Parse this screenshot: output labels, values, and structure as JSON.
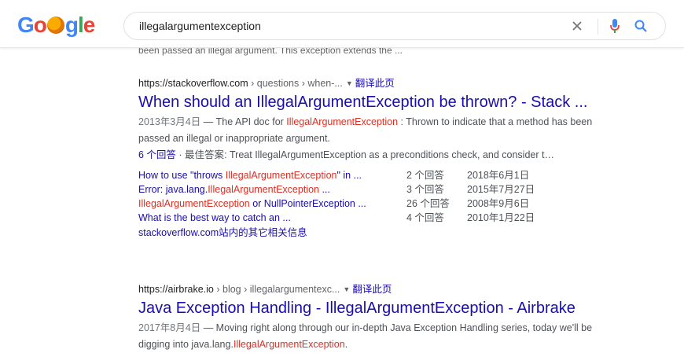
{
  "logo": {
    "text": "Google"
  },
  "search": {
    "query": "illegalargumentexception"
  },
  "cut_snippet": "been passed an illegal argument. This exception extends the ...",
  "results": [
    {
      "url": "https://stackoverflow.com",
      "crumbs": " › questions › when-...",
      "translate": "翻译此页",
      "title": "When should an IllegalArgumentException be thrown? - Stack ...",
      "snippet_date": "2013年3月4日",
      "snippet_p1": " — The API doc for ",
      "snippet_hl1": "IllegalArgumentException",
      "snippet_p2": " : Thrown to indicate that a method has been passed an illegal or inappropriate argument.",
      "answers_link": "6 个回答",
      "answers_sep": " · ",
      "answers_best_label": "最佳答案",
      "answers_text": ": Treat IllegalArgumentException as a preconditions check, and consider t…",
      "sitelinks": [
        {
          "pre": "How to use \"throws ",
          "hl": "IllegalArgumentException",
          "post": "\" in ...",
          "count": "2 个回答",
          "date": "2018年6月1日"
        },
        {
          "pre": "Error: java.lang.",
          "hl": "IllegalArgumentException",
          "post": " ...",
          "count": "3 个回答",
          "date": "2015年7月27日"
        },
        {
          "pre": "",
          "hl": "IllegalArgumentException",
          "post": " or NullPointerException ...",
          "count": "26 个回答",
          "date": "2008年9月6日"
        },
        {
          "pre": "What is the best way to catch an ...",
          "hl": "",
          "post": "",
          "count": "4 个回答",
          "date": "2010年1月22日"
        }
      ],
      "more": "stackoverflow.com站内的其它相关信息"
    },
    {
      "url": "https://airbrake.io",
      "crumbs": " › blog › illegalargumentexc...",
      "translate": "翻译此页",
      "title": "Java Exception Handling - IllegalArgumentException - Airbrake",
      "snippet_date": "2017年8月4日",
      "snippet_p1": " — Moving right along through our in-depth Java Exception Handling series, today we'll be digging into java.lang.",
      "snippet_hl1": "IllegalArgumentException",
      "snippet_p2": "."
    }
  ]
}
